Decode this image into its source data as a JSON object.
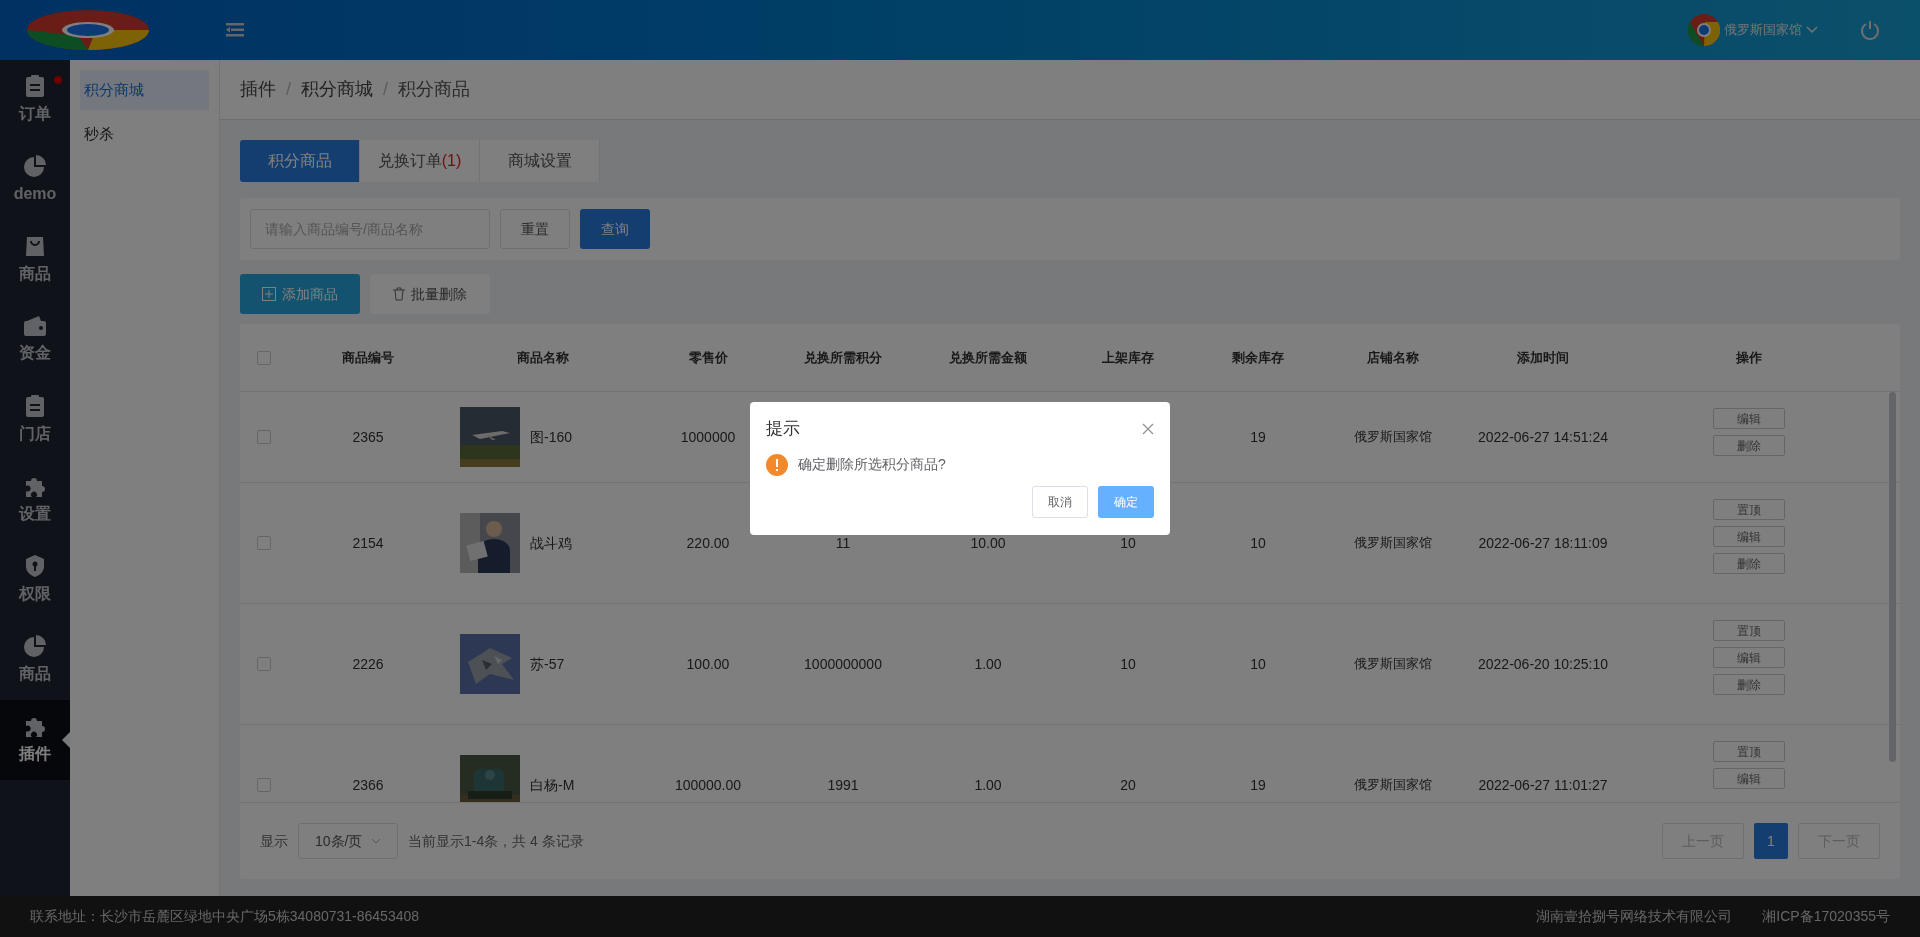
{
  "header": {
    "store_name": "俄罗斯国家馆"
  },
  "nav": [
    {
      "label": "订单",
      "selected": false,
      "notification": true
    },
    {
      "label": "demo",
      "selected": false,
      "notification": false
    },
    {
      "label": "商品",
      "selected": false,
      "notification": false
    },
    {
      "label": "资金",
      "selected": false,
      "notification": false
    },
    {
      "label": "门店",
      "selected": false,
      "notification": false
    },
    {
      "label": "设置",
      "selected": false,
      "notification": false
    },
    {
      "label": "权限",
      "selected": false,
      "notification": false
    },
    {
      "label": "商品",
      "selected": false,
      "notification": false
    },
    {
      "label": "插件",
      "selected": true,
      "notification": false
    }
  ],
  "submenu": [
    {
      "label": "积分商城",
      "selected": true
    },
    {
      "label": "秒杀",
      "selected": false
    }
  ],
  "breadcrumb": [
    {
      "kind": "link",
      "text": "插件"
    },
    {
      "kind": "separator",
      "text": "/"
    },
    {
      "kind": "link",
      "text": "积分商城"
    },
    {
      "kind": "separator",
      "text": "/"
    },
    {
      "kind": "current",
      "text": "积分商品"
    }
  ],
  "tabs": [
    {
      "label": "积分商品",
      "selected": true
    },
    {
      "label": "兑换订单",
      "count": "(1)",
      "selected": false
    },
    {
      "label": "商城设置",
      "selected": false
    }
  ],
  "search": {
    "placeholder": "请输入商品编号/商品名称",
    "reset": "重置",
    "submit": "查询"
  },
  "actions": {
    "add": "添加商品",
    "batch_delete": "批量删除"
  },
  "table": {
    "all_checked": false,
    "columns": [
      "商品编号",
      "商品名称",
      "零售价",
      "兑换所需积分",
      "兑换所需金额",
      "上架库存",
      "剩余库存",
      "店铺名称",
      "添加时间",
      "操作"
    ],
    "rows": [
      {
        "checked": false,
        "id": "2365",
        "image": {
          "kind": "picture"
        },
        "name": "图-160",
        "price": "1000000",
        "remaining": "19",
        "store": "俄罗斯国家馆",
        "time": "2022-06-27 14:51:24",
        "ops": [
          "编辑",
          "删除"
        ]
      },
      {
        "checked": false,
        "id": "2154",
        "image": {
          "kind": "picture"
        },
        "name": "战斗鸡",
        "price": "220.00",
        "points": "11",
        "amount": "10.00",
        "stock": "10",
        "remaining": "10",
        "store": "俄罗斯国家馆",
        "time": "2022-06-27 18:11:09",
        "ops": [
          "置顶",
          "编辑",
          "删除"
        ]
      },
      {
        "checked": false,
        "id": "2226",
        "image": {
          "kind": "picture"
        },
        "name": "苏-57",
        "price": "100.00",
        "points": "1000000000",
        "amount": "1.00",
        "stock": "10",
        "remaining": "10",
        "store": "俄罗斯国家馆",
        "time": "2022-06-20 10:25:10",
        "ops": [
          "置顶",
          "编辑",
          "删除"
        ]
      },
      {
        "checked": false,
        "id": "2366",
        "image": {
          "kind": "picture"
        },
        "name": "白杨-M",
        "price": "100000.00",
        "points": "1991",
        "amount": "1.00",
        "stock": "20",
        "remaining": "19",
        "store": "俄罗斯国家馆",
        "time": "2022-06-27 11:01:27",
        "ops": [
          "置顶",
          "编辑"
        ]
      }
    ]
  },
  "pagination": {
    "show": "显示",
    "page_size": "10条/页",
    "summary": "当前显示1-4条，共 4 条记录",
    "prev": {
      "label": "上一页",
      "disabled": true
    },
    "pages": [
      {
        "label": "1",
        "selected": true
      }
    ],
    "next": {
      "label": "下一页",
      "disabled": true
    }
  },
  "footer": {
    "address": "联系地址：长沙市岳麓区绿地中央广场5栋34080731-86453408",
    "company": "湖南壹拾捌号网络技术有限公司",
    "icp": "湘ICP备17020355号"
  },
  "dialog": {
    "title": "提示",
    "message": "确定删除所选积分商品?",
    "cancel": "取消",
    "confirm": "确定"
  }
}
